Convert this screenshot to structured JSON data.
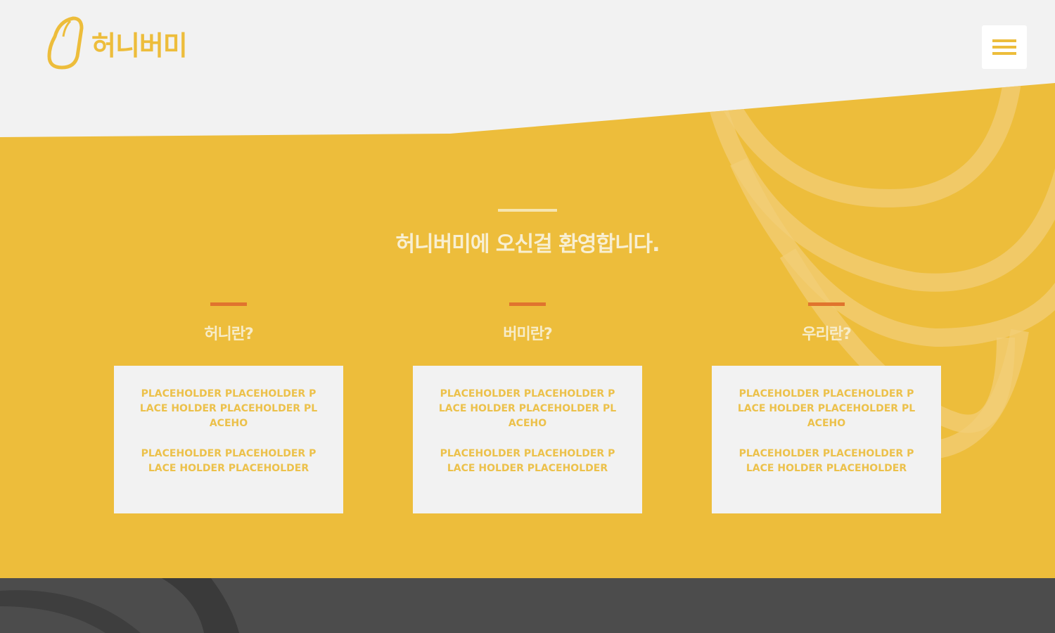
{
  "header": {
    "logo_text": "허니버미",
    "menu_icon": "hamburger-menu-icon"
  },
  "hero": {
    "title": "허니버미에 오신걸 환영합니다."
  },
  "columns": [
    {
      "title": "허니란?",
      "paragraphs": [
        "PLACEHOLDER PLACEHOLDER PLACE HOLDER PLACEHOLDER PLACEHO",
        "PLACEHOLDER PLACEHOLDER PLACE HOLDER PLACEHOLDER"
      ]
    },
    {
      "title": "버미란?",
      "paragraphs": [
        "PLACEHOLDER PLACEHOLDER PLACE HOLDER PLACEHOLDER PLACEHO",
        "PLACEHOLDER PLACEHOLDER PLACE HOLDER PLACEHOLDER"
      ]
    },
    {
      "title": "우리란?",
      "paragraphs": [
        "PLACEHOLDER PLACEHOLDER PLACE HOLDER PLACEHOLDER PLACEHO",
        "PLACEHOLDER PLACEHOLDER PLACE HOLDER PLACEHOLDER"
      ]
    }
  ],
  "colors": {
    "brand_yellow": "#edbd3b",
    "accent_orange": "#e0742e",
    "background_light": "#f2f2f2",
    "footer_dark": "#4c4c4c"
  }
}
